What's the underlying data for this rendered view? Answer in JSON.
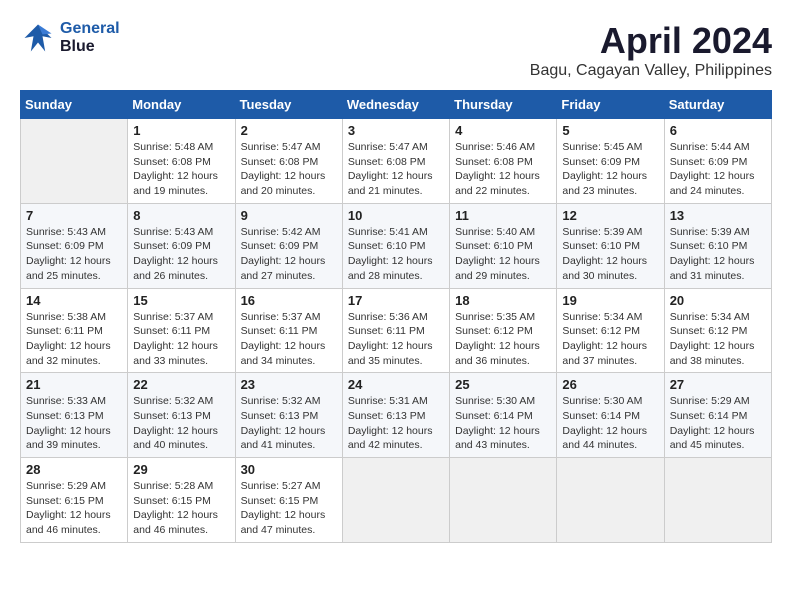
{
  "header": {
    "logo_line1": "General",
    "logo_line2": "Blue",
    "title": "April 2024",
    "subtitle": "Bagu, Cagayan Valley, Philippines"
  },
  "days_of_week": [
    "Sunday",
    "Monday",
    "Tuesday",
    "Wednesday",
    "Thursday",
    "Friday",
    "Saturday"
  ],
  "weeks": [
    [
      {
        "day": "",
        "empty": true
      },
      {
        "day": "1",
        "sunrise": "5:48 AM",
        "sunset": "6:08 PM",
        "daylight": "12 hours and 19 minutes."
      },
      {
        "day": "2",
        "sunrise": "5:47 AM",
        "sunset": "6:08 PM",
        "daylight": "12 hours and 20 minutes."
      },
      {
        "day": "3",
        "sunrise": "5:47 AM",
        "sunset": "6:08 PM",
        "daylight": "12 hours and 21 minutes."
      },
      {
        "day": "4",
        "sunrise": "5:46 AM",
        "sunset": "6:08 PM",
        "daylight": "12 hours and 22 minutes."
      },
      {
        "day": "5",
        "sunrise": "5:45 AM",
        "sunset": "6:09 PM",
        "daylight": "12 hours and 23 minutes."
      },
      {
        "day": "6",
        "sunrise": "5:44 AM",
        "sunset": "6:09 PM",
        "daylight": "12 hours and 24 minutes."
      }
    ],
    [
      {
        "day": "7",
        "sunrise": "5:43 AM",
        "sunset": "6:09 PM",
        "daylight": "12 hours and 25 minutes."
      },
      {
        "day": "8",
        "sunrise": "5:43 AM",
        "sunset": "6:09 PM",
        "daylight": "12 hours and 26 minutes."
      },
      {
        "day": "9",
        "sunrise": "5:42 AM",
        "sunset": "6:09 PM",
        "daylight": "12 hours and 27 minutes."
      },
      {
        "day": "10",
        "sunrise": "5:41 AM",
        "sunset": "6:10 PM",
        "daylight": "12 hours and 28 minutes."
      },
      {
        "day": "11",
        "sunrise": "5:40 AM",
        "sunset": "6:10 PM",
        "daylight": "12 hours and 29 minutes."
      },
      {
        "day": "12",
        "sunrise": "5:39 AM",
        "sunset": "6:10 PM",
        "daylight": "12 hours and 30 minutes."
      },
      {
        "day": "13",
        "sunrise": "5:39 AM",
        "sunset": "6:10 PM",
        "daylight": "12 hours and 31 minutes."
      }
    ],
    [
      {
        "day": "14",
        "sunrise": "5:38 AM",
        "sunset": "6:11 PM",
        "daylight": "12 hours and 32 minutes."
      },
      {
        "day": "15",
        "sunrise": "5:37 AM",
        "sunset": "6:11 PM",
        "daylight": "12 hours and 33 minutes."
      },
      {
        "day": "16",
        "sunrise": "5:37 AM",
        "sunset": "6:11 PM",
        "daylight": "12 hours and 34 minutes."
      },
      {
        "day": "17",
        "sunrise": "5:36 AM",
        "sunset": "6:11 PM",
        "daylight": "12 hours and 35 minutes."
      },
      {
        "day": "18",
        "sunrise": "5:35 AM",
        "sunset": "6:12 PM",
        "daylight": "12 hours and 36 minutes."
      },
      {
        "day": "19",
        "sunrise": "5:34 AM",
        "sunset": "6:12 PM",
        "daylight": "12 hours and 37 minutes."
      },
      {
        "day": "20",
        "sunrise": "5:34 AM",
        "sunset": "6:12 PM",
        "daylight": "12 hours and 38 minutes."
      }
    ],
    [
      {
        "day": "21",
        "sunrise": "5:33 AM",
        "sunset": "6:13 PM",
        "daylight": "12 hours and 39 minutes."
      },
      {
        "day": "22",
        "sunrise": "5:32 AM",
        "sunset": "6:13 PM",
        "daylight": "12 hours and 40 minutes."
      },
      {
        "day": "23",
        "sunrise": "5:32 AM",
        "sunset": "6:13 PM",
        "daylight": "12 hours and 41 minutes."
      },
      {
        "day": "24",
        "sunrise": "5:31 AM",
        "sunset": "6:13 PM",
        "daylight": "12 hours and 42 minutes."
      },
      {
        "day": "25",
        "sunrise": "5:30 AM",
        "sunset": "6:14 PM",
        "daylight": "12 hours and 43 minutes."
      },
      {
        "day": "26",
        "sunrise": "5:30 AM",
        "sunset": "6:14 PM",
        "daylight": "12 hours and 44 minutes."
      },
      {
        "day": "27",
        "sunrise": "5:29 AM",
        "sunset": "6:14 PM",
        "daylight": "12 hours and 45 minutes."
      }
    ],
    [
      {
        "day": "28",
        "sunrise": "5:29 AM",
        "sunset": "6:15 PM",
        "daylight": "12 hours and 46 minutes."
      },
      {
        "day": "29",
        "sunrise": "5:28 AM",
        "sunset": "6:15 PM",
        "daylight": "12 hours and 46 minutes."
      },
      {
        "day": "30",
        "sunrise": "5:27 AM",
        "sunset": "6:15 PM",
        "daylight": "12 hours and 47 minutes."
      },
      {
        "day": "",
        "empty": true
      },
      {
        "day": "",
        "empty": true
      },
      {
        "day": "",
        "empty": true
      },
      {
        "day": "",
        "empty": true
      }
    ]
  ],
  "labels": {
    "sunrise_prefix": "Sunrise: ",
    "sunset_prefix": "Sunset: ",
    "daylight_prefix": "Daylight: "
  }
}
